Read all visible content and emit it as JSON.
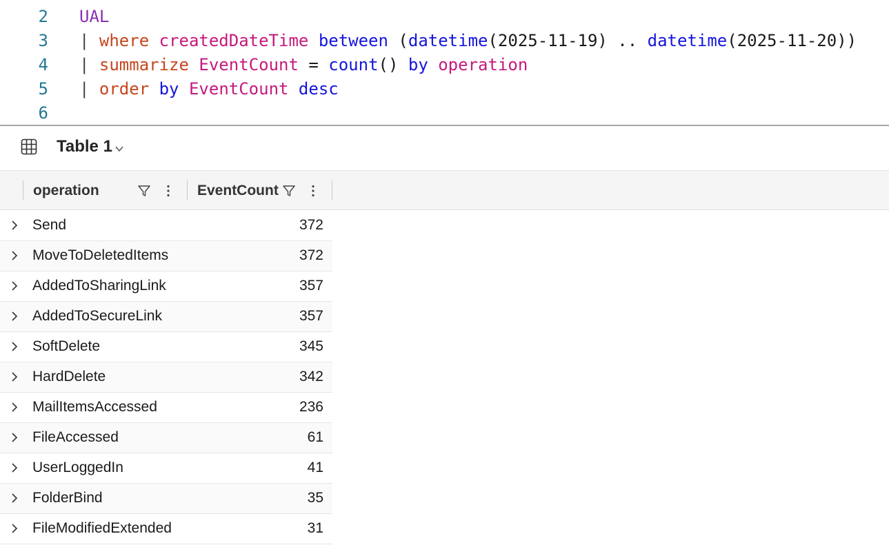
{
  "editor": {
    "lines": [
      {
        "number": "2",
        "tokens": [
          {
            "text": "UAL",
            "kind": "table"
          }
        ]
      },
      {
        "number": "3",
        "tokens": [
          {
            "text": "| ",
            "kind": "pipe"
          },
          {
            "text": "where",
            "kind": "op"
          },
          {
            "text": " ",
            "kind": "txt"
          },
          {
            "text": "createdDateTime",
            "kind": "col"
          },
          {
            "text": " ",
            "kind": "txt"
          },
          {
            "text": "between",
            "kind": "kw"
          },
          {
            "text": " (",
            "kind": "txt"
          },
          {
            "text": "datetime",
            "kind": "kw"
          },
          {
            "text": "(2025-11-19) .. ",
            "kind": "txt"
          },
          {
            "text": "datetime",
            "kind": "kw"
          },
          {
            "text": "(2025-11-20))",
            "kind": "txt"
          }
        ]
      },
      {
        "number": "4",
        "tokens": [
          {
            "text": "| ",
            "kind": "pipe"
          },
          {
            "text": "summarize",
            "kind": "op"
          },
          {
            "text": " ",
            "kind": "txt"
          },
          {
            "text": "EventCount",
            "kind": "col"
          },
          {
            "text": " = ",
            "kind": "txt"
          },
          {
            "text": "count",
            "kind": "kw"
          },
          {
            "text": "() ",
            "kind": "txt"
          },
          {
            "text": "by",
            "kind": "kw"
          },
          {
            "text": " ",
            "kind": "txt"
          },
          {
            "text": "operation",
            "kind": "col"
          }
        ]
      },
      {
        "number": "5",
        "tokens": [
          {
            "text": "| ",
            "kind": "pipe"
          },
          {
            "text": "order",
            "kind": "op"
          },
          {
            "text": " ",
            "kind": "txt"
          },
          {
            "text": "by",
            "kind": "kw"
          },
          {
            "text": " ",
            "kind": "txt"
          },
          {
            "text": "EventCount",
            "kind": "col"
          },
          {
            "text": " ",
            "kind": "txt"
          },
          {
            "text": "desc",
            "kind": "kw"
          }
        ]
      },
      {
        "number": "6",
        "tokens": []
      }
    ]
  },
  "results": {
    "tab_label": "Table 1",
    "columns": [
      "operation",
      "EventCount"
    ],
    "rows": [
      {
        "operation": "Send",
        "count": "372"
      },
      {
        "operation": "MoveToDeletedItems",
        "count": "372"
      },
      {
        "operation": "AddedToSharingLink",
        "count": "357"
      },
      {
        "operation": "AddedToSecureLink",
        "count": "357"
      },
      {
        "operation": "SoftDelete",
        "count": "345"
      },
      {
        "operation": "HardDelete",
        "count": "342"
      },
      {
        "operation": "MailItemsAccessed",
        "count": "236"
      },
      {
        "operation": "FileAccessed",
        "count": "61"
      },
      {
        "operation": "UserLoggedIn",
        "count": "41"
      },
      {
        "operation": "FolderBind",
        "count": "35"
      },
      {
        "operation": "FileModifiedExtended",
        "count": "31"
      }
    ]
  },
  "colors": {
    "table": "#8a2fb3",
    "operator": "#c5461c",
    "keyword": "#1515dc",
    "column": "#c5197c",
    "line_number": "#237893"
  }
}
